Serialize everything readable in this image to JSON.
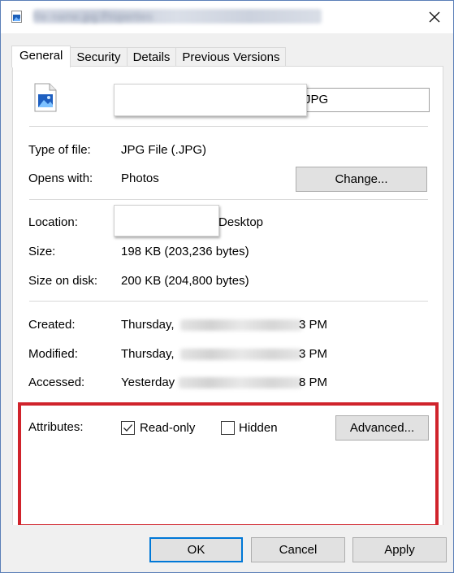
{
  "window": {
    "title_obscured": "file name.jpg Properties"
  },
  "tabs": [
    "General",
    "Security",
    "Details",
    "Previous Versions"
  ],
  "general": {
    "filename_suffix": "JPG",
    "type_label": "Type of file:",
    "type_value": "JPG File (.JPG)",
    "opens_label": "Opens with:",
    "opens_value": "Photos",
    "change_button": "Change...",
    "location_label": "Location:",
    "location_value_suffix": "Desktop",
    "size_label": "Size:",
    "size_value": "198 KB (203,236 bytes)",
    "size_disk_label": "Size on disk:",
    "size_disk_value": "200 KB (204,800 bytes)",
    "created_label": "Created:",
    "created_prefix": "Thursday,",
    "created_suffix": "3 PM",
    "modified_label": "Modified:",
    "modified_prefix": "Thursday,",
    "modified_suffix": "3 PM",
    "accessed_label": "Accessed:",
    "accessed_prefix": "Yesterday",
    "accessed_suffix": "8 PM",
    "attributes_label": "Attributes:",
    "readonly_label": "Read-only",
    "readonly_checked": true,
    "hidden_label": "Hidden",
    "hidden_checked": false,
    "advanced_button": "Advanced..."
  },
  "footer": {
    "ok": "OK",
    "cancel": "Cancel",
    "apply": "Apply"
  },
  "colors": {
    "highlight": "#d0232b",
    "ok_border": "#0078d7"
  }
}
